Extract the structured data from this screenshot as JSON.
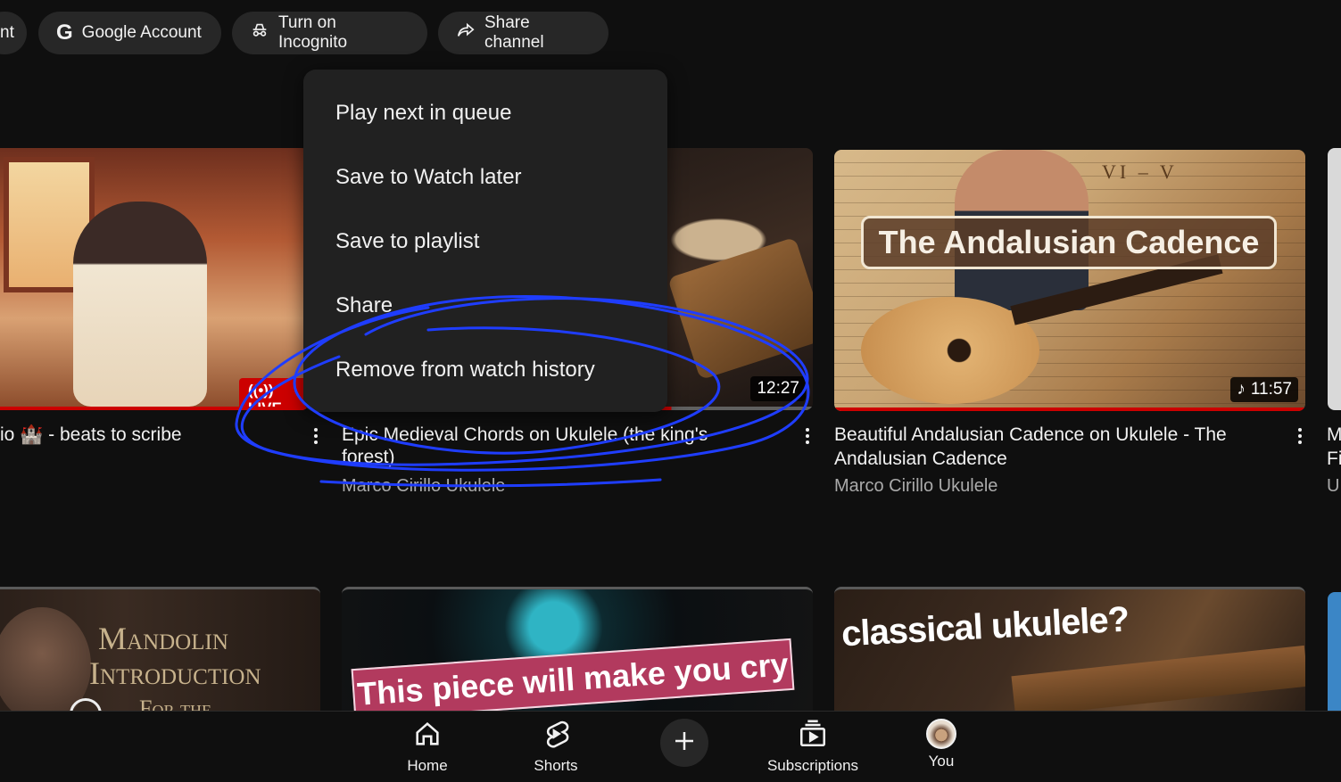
{
  "chips": [
    {
      "label": "nt",
      "icon": "partial-chip"
    },
    {
      "label": "Google Account",
      "icon": "google-g-icon"
    },
    {
      "label": "Turn on Incognito",
      "icon": "incognito-icon"
    },
    {
      "label": "Share channel",
      "icon": "share-icon"
    }
  ],
  "menu": {
    "items": [
      "Play next in queue",
      "Save to Watch later",
      "Save to playlist",
      "Share",
      "Remove from watch history"
    ]
  },
  "videos": [
    {
      "title": "io 🏰 - beats to scribe",
      "badge": "LIVE"
    },
    {
      "title_line1": "Epic Medieval Chords on Ukulele (the king's",
      "title_line2": "forest)",
      "channel": "Marco Cirillo Ukulele",
      "duration": "12:27"
    },
    {
      "title_line1": "Beautiful Andalusian Cadence on Ukulele - The",
      "title_line2": "Andalusian Cadence",
      "channel": "Marco Cirillo Ukulele",
      "duration": "11:57",
      "thumb_text": "The Andalusian Cadence",
      "sheet_text": "VI – V"
    },
    {
      "title_line1": "M",
      "title_line2": "Fi",
      "channel": "U"
    }
  ],
  "row2": [
    {
      "line1": "Mandolin",
      "line2": "Introduction",
      "line3": "For the"
    },
    {
      "caption": "This piece will make you cry"
    },
    {
      "caption": "classical ukulele?"
    }
  ],
  "nav": {
    "home": "Home",
    "shorts": "Shorts",
    "create": "",
    "subscriptions": "Subscriptions",
    "you": "You"
  },
  "colors": {
    "background": "#0f0f0f",
    "menu": "#212121",
    "chip": "#272727",
    "progress": "#cc0000",
    "annotation": "#1f3dff"
  }
}
